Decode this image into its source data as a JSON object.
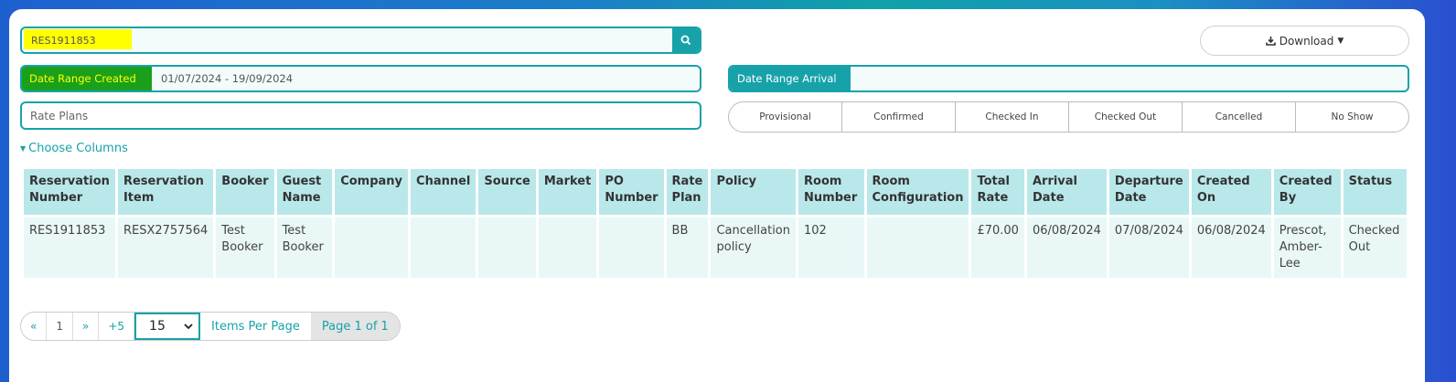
{
  "search": {
    "value": "RES1911853"
  },
  "download": {
    "label": "Download"
  },
  "date_range_created": {
    "label": "Date Range Created",
    "value": "01/07/2024 - 19/09/2024"
  },
  "date_range_arrival": {
    "label": "Date Range Arrival",
    "value": ""
  },
  "rate_plans": {
    "placeholder": "Rate Plans"
  },
  "status_filters": [
    "Provisional",
    "Confirmed",
    "Checked In",
    "Checked Out",
    "Cancelled",
    "No Show"
  ],
  "choose_columns": "Choose Columns",
  "table": {
    "headers": [
      "Reservation Number",
      "Reservation Item",
      "Booker",
      "Guest Name",
      "Company",
      "Channel",
      "Source",
      "Market",
      "PO Number",
      "Rate Plan",
      "Policy",
      "Room Number",
      "Room Configuration",
      "Total Rate",
      "Arrival Date",
      "Departure Date",
      "Created On",
      "Created By",
      "Status"
    ],
    "rows": [
      [
        "RES1911853",
        "RESX2757564",
        "Test Booker",
        "Test Booker",
        "",
        "",
        "",
        "",
        "",
        "BB",
        "Cancellation policy",
        "102",
        "",
        "£70.00",
        "06/08/2024",
        "07/08/2024",
        "06/08/2024",
        "Prescot, Amber-Lee",
        "Checked Out"
      ]
    ]
  },
  "pagination": {
    "first": "«",
    "page": "1",
    "next": "»",
    "plus5": "+5",
    "per_page": "15",
    "items_per_page": "Items Per Page",
    "page_of": "Page 1 of 1"
  },
  "colors": {
    "accent": "#17a2aa",
    "highlight": "#ffff00",
    "highlight_green": "#1aa01a"
  }
}
